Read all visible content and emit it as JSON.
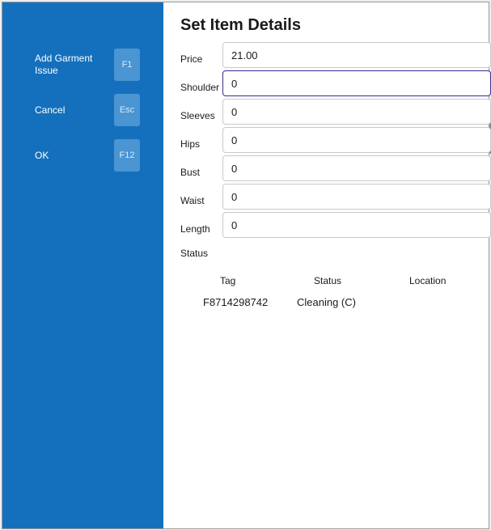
{
  "sidebar": {
    "actions": [
      {
        "label": "Add Garment Issue",
        "key": "F1"
      },
      {
        "label": "Cancel",
        "key": "Esc"
      },
      {
        "label": "OK",
        "key": "F12"
      }
    ]
  },
  "dialog": {
    "title": "Set Item Details",
    "fields": [
      {
        "label": "Price",
        "value": "21.00"
      },
      {
        "label": "Shoulder",
        "value": "0"
      },
      {
        "label": "Sleeves",
        "value": "0"
      },
      {
        "label": "Hips",
        "value": "0"
      },
      {
        "label": "Bust",
        "value": "0"
      },
      {
        "label": "Waist",
        "value": "0"
      },
      {
        "label": "Length",
        "value": "0"
      }
    ],
    "status_label": "Status",
    "table": {
      "headers": [
        "Tag",
        "Status",
        "Location"
      ],
      "rows": [
        {
          "tag": "F8714298742",
          "status": "Cleaning (C)",
          "location": ""
        }
      ]
    }
  }
}
